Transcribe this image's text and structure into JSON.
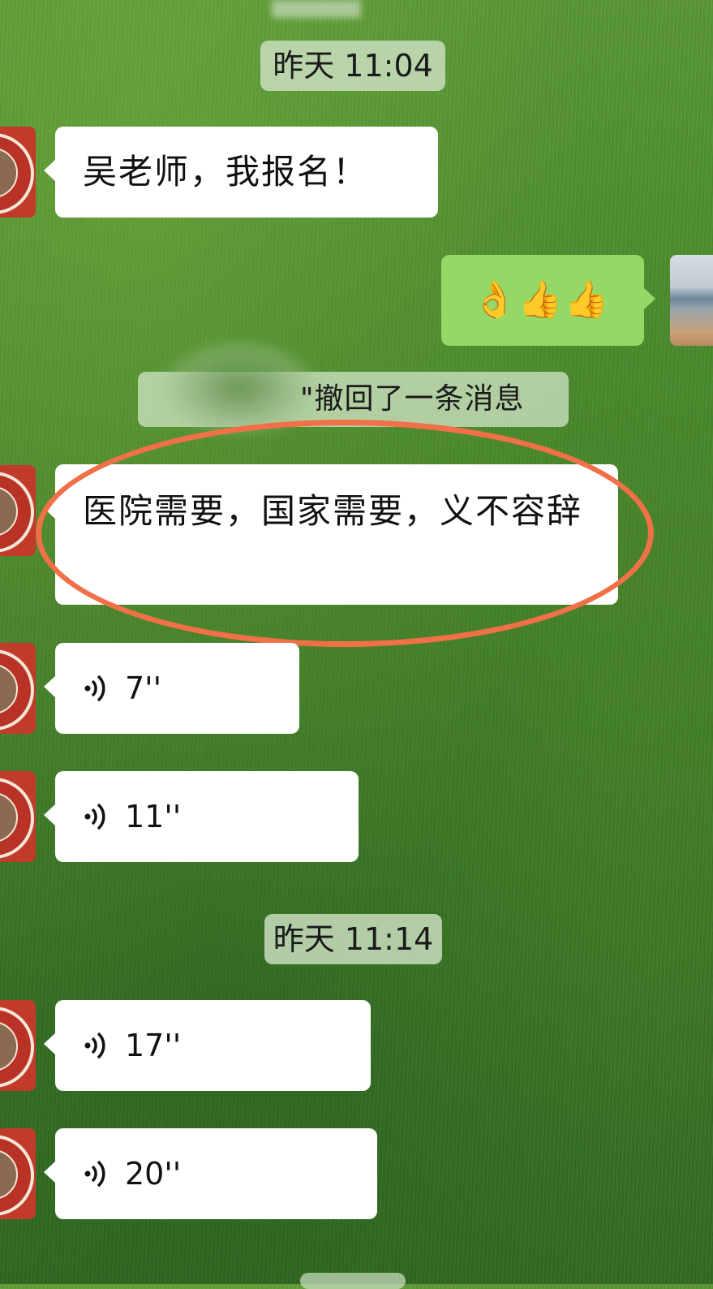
{
  "chat": {
    "timestamps": [
      "昨天 11:04",
      "昨天 11:14"
    ],
    "messages": {
      "m1": "吴老师，我报名！",
      "m2": "👌👍👍",
      "recall": "\"撤回了一条消息",
      "m3": "医院需要，国家需要，义不容辞",
      "v1": "7''",
      "v2": "11''",
      "v3": "17''",
      "v4": "20''"
    }
  },
  "colors": {
    "outgoing_bubble": "#95d865",
    "incoming_bubble": "#ffffff",
    "highlight_circle": "#f07048",
    "time_pill": "#cde1c3"
  },
  "icons": [
    "voice-wave-icon",
    "avatar",
    "my-avatar"
  ]
}
